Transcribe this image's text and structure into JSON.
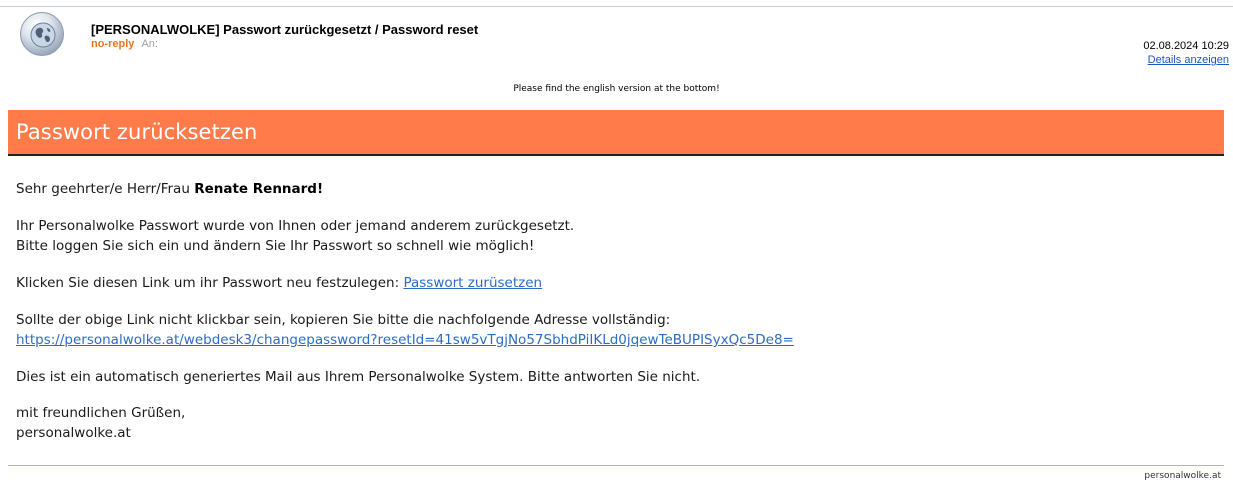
{
  "header": {
    "subject": "[PERSONALWOLKE] Passwort zurückgesetzt / Password reset",
    "sender": "no-reply",
    "to_label": "An:",
    "date": "02.08.2024 10:29",
    "details_link": "Details anzeigen",
    "avatar_icon": "globe-icon"
  },
  "notice": "Please find the english version at the bottom!",
  "banner": {
    "title": "Passwort zurücksetzen",
    "color": "#ff7b4a"
  },
  "body": {
    "greeting_prefix": "Sehr geehrter/e Herr/Frau ",
    "greeting_name": "Renate Rennard!",
    "para1_line1": "Ihr Personalwolke Passwort wurde von Ihnen oder jemand anderem zurückgesetzt.",
    "para1_line2": "Bitte loggen Sie sich ein und ändern Sie Ihr Passwort so schnell wie möglich!",
    "link_prefix": "Klicken Sie diesen Link um ihr Passwort neu festzulegen: ",
    "link_text": "Passwort zurüsetzen",
    "fallback_text": "Sollte der obige Link nicht klickbar sein, kopieren Sie bitte die nachfolgende Adresse vollständig:",
    "fallback_url": "https://personalwolke.at/webdesk3/changepassword?resetId=41sw5vTgjNo57SbhdPiIKLd0jqewTeBUPISyxQc5De8=",
    "auto_notice": "Dies ist ein automatisch generiertes Mail aus Ihrem Personalwolke System. Bitte antworten Sie nicht.",
    "closing": "mit freundlichen Grüßen,",
    "signature": "personalwolke.at"
  },
  "footer": "personalwolke.at"
}
